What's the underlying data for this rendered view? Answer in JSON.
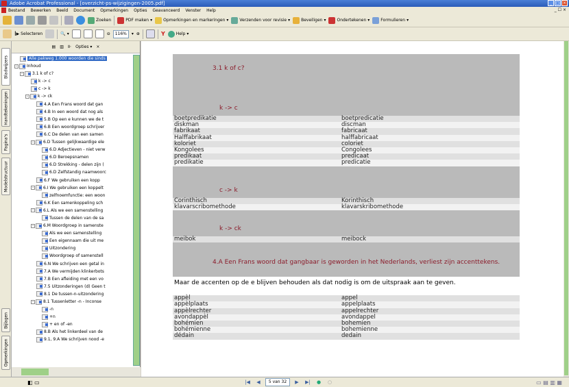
{
  "window": {
    "title": "Adobe Acrobat Professional - [overzicht-ps-wijzigingen-2005.pdf]"
  },
  "menu": [
    "Bestand",
    "Bewerken",
    "Beeld",
    "Document",
    "Opmerkingen",
    "Opties",
    "Geavanceerd",
    "Venster",
    "Help"
  ],
  "toolbar1": {
    "search_label": "Zoeken",
    "pdf_label": "PDF maken",
    "comments_label": "Opmerkingen en markeringen",
    "send_label": "Verzenden voor revisie",
    "secure_label": "Beveiligen",
    "sign_label": "Ondertekenen",
    "forms_label": "Formulieren"
  },
  "toolbar2": {
    "select_label": "Selecteren",
    "zoom_value": "116%",
    "help_label": "Help"
  },
  "navtabs": [
    "Bladwijzers",
    "Handtekeningen",
    "Pagina's",
    "Modelstructuur",
    "Bijlagen",
    "Opmerkingen"
  ],
  "bookmark_panel": {
    "options_label": "Opties"
  },
  "bookmarks": [
    {
      "level": 0,
      "label": "Alle pakweg 1.000 woorden die sinds",
      "selected": true,
      "exp": ""
    },
    {
      "level": 0,
      "label": "Inhoud",
      "exp": "-"
    },
    {
      "level": 1,
      "label": "3.1 k of c?",
      "exp": "-"
    },
    {
      "level": 2,
      "label": "k -> c",
      "exp": ""
    },
    {
      "level": 2,
      "label": "c -> k",
      "exp": ""
    },
    {
      "level": 2,
      "label": "k -> ck",
      "exp": "-"
    },
    {
      "level": 3,
      "label": "4.A Een Frans woord dat gan",
      "exp": ""
    },
    {
      "level": 3,
      "label": "4.B In een woord dat nog als",
      "exp": ""
    },
    {
      "level": 3,
      "label": "5.B Op een e kunnen we de t",
      "exp": ""
    },
    {
      "level": 3,
      "label": "6.B Een woordgroep schrijver",
      "exp": ""
    },
    {
      "level": 3,
      "label": "6.C De delen van een samen",
      "exp": ""
    },
    {
      "level": 3,
      "label": "6.D Tussen gelijkwaardige ele",
      "exp": "-"
    },
    {
      "level": 4,
      "label": "6.D Adjectieven - niet verw",
      "exp": ""
    },
    {
      "level": 4,
      "label": "6.D Beroepsnamen",
      "exp": ""
    },
    {
      "level": 4,
      "label": "6.D Strekking - delen zijn (",
      "exp": ""
    },
    {
      "level": 4,
      "label": "6.D Zelfstandig naamwoorc",
      "exp": ""
    },
    {
      "level": 3,
      "label": "6.F We gebruiken een kopp",
      "exp": ""
    },
    {
      "level": 3,
      "label": "6.I We gebruiken een koppelt",
      "exp": "-"
    },
    {
      "level": 4,
      "label": "zelfnoemfunctie: een woon",
      "exp": ""
    },
    {
      "level": 3,
      "label": "6.K Een samenkoppeling sch",
      "exp": ""
    },
    {
      "level": 3,
      "label": "6.L Als we een samenstelling",
      "exp": "-"
    },
    {
      "level": 4,
      "label": "Tussen de delen van de sa",
      "exp": ""
    },
    {
      "level": 3,
      "label": "6.M Woordgroep in samenste",
      "exp": "-"
    },
    {
      "level": 4,
      "label": "Als we een samenstelling",
      "exp": ""
    },
    {
      "level": 4,
      "label": "Een eigennaam die uit me",
      "exp": ""
    },
    {
      "level": 4,
      "label": "Uitzondering",
      "exp": ""
    },
    {
      "level": 4,
      "label": "Woordgroep of samenstell",
      "exp": ""
    },
    {
      "level": 3,
      "label": "6.N We schrijven een getal in",
      "exp": ""
    },
    {
      "level": 3,
      "label": "7.A We vermijden klinkerbots",
      "exp": ""
    },
    {
      "level": 3,
      "label": "7.B Een afleiding met een vo",
      "exp": ""
    },
    {
      "level": 3,
      "label": "7.5 Uitzonderingen (d) Geen t",
      "exp": ""
    },
    {
      "level": 3,
      "label": "8.1 De tussen-n-uitzondering",
      "exp": ""
    },
    {
      "level": 3,
      "label": "8.1 Tussenletter -n - Inconse",
      "exp": "-"
    },
    {
      "level": 4,
      "label": "-n",
      "exp": ""
    },
    {
      "level": 4,
      "label": "+n",
      "exp": ""
    },
    {
      "level": 4,
      "label": "+ en of -en",
      "exp": ""
    },
    {
      "level": 3,
      "label": "8.B Als het linkerdeel van de",
      "exp": ""
    },
    {
      "level": 3,
      "label": "9.1, 9.A We schrijven nood -e",
      "exp": ""
    }
  ],
  "document": {
    "section_title": "3.1 k of c?",
    "blocks": [
      {
        "heading": "k -> c",
        "rows": [
          [
            "boetpredikatie",
            "boetpredicatie"
          ],
          [
            "diskman",
            "discman"
          ],
          [
            "fabrikaat",
            "fabricaat"
          ],
          [
            "Halffabrikaat",
            "halffabricaat"
          ],
          [
            "koloriet",
            "coloriet"
          ],
          [
            "Kongolees",
            "Congolees"
          ],
          [
            "predikaat",
            "predicaat"
          ],
          [
            "predikatie",
            "predicatie"
          ]
        ]
      },
      {
        "heading": "c -> k",
        "rows": [
          [
            "Corinthisch",
            "Korinthisch"
          ],
          [
            "klavarscribomethode",
            "klavarskribomethode"
          ]
        ]
      },
      {
        "heading": "k -> ck",
        "rows": [
          [
            "meibok",
            "meibock"
          ]
        ]
      }
    ],
    "rule_heading": "4.A Een Frans woord dat gangbaar is geworden in het Nederlands, verliest zijn accenttekens.",
    "rule_para": "Maar de accenten op de e blijven behouden als dat nodig is om de uitspraak aan te geven.",
    "rule_rows": [
      [
        "appèl",
        "appel"
      ],
      [
        "appèlplaats",
        "appelplaats"
      ],
      [
        "appèlrechter",
        "appelrechter"
      ],
      [
        "avondappèl",
        "avondappel"
      ],
      [
        "bohémien",
        "bohemien"
      ],
      [
        "bohémienne",
        "bohemienne"
      ],
      [
        "dédain",
        "dedain"
      ]
    ]
  },
  "status": {
    "page_indicator": "5 van 32"
  }
}
